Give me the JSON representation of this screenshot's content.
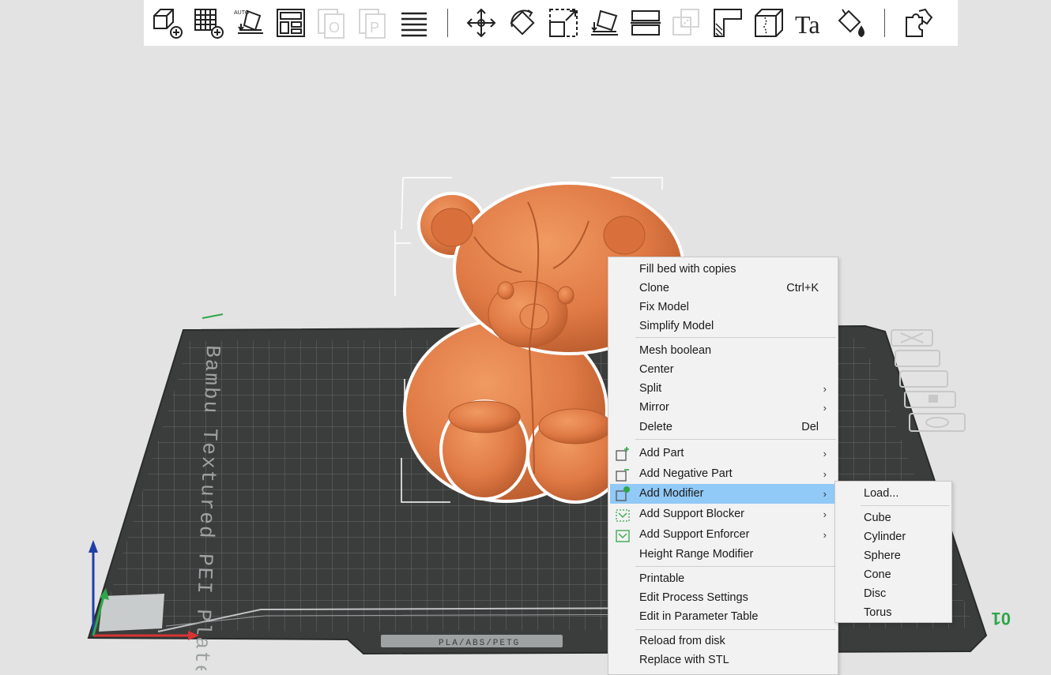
{
  "toolbar": {
    "groups": [
      [
        "add-object-icon",
        "add-plate-icon",
        "auto-orient-icon",
        "arrange-icon",
        "copy-disabled-icon",
        "paste-disabled-icon",
        "list-icon"
      ],
      [
        "move-icon",
        "rotate-icon",
        "scale-icon",
        "lay-on-face-icon",
        "cut-icon",
        "boolean-disabled-icon",
        "support-paint-icon",
        "seam-paint-icon",
        "text-icon",
        "color-paint-icon"
      ],
      [
        "assembly-icon"
      ]
    ],
    "auto_label": "AUTO",
    "text_glyph": "Ta"
  },
  "plate": {
    "name": "Bambu Textured PEI Plate",
    "material": "PLA/ABS/PETG",
    "number": "01",
    "top_color": "#3b3d3d",
    "grid_color": "#6b6d6d"
  },
  "model": {
    "name": "teddy-bear",
    "color": "#e07a45"
  },
  "context_menu": {
    "items": [
      {
        "label": "Fill bed with copies",
        "shortcut": ""
      },
      {
        "label": "Clone",
        "shortcut": "Ctrl+K"
      },
      {
        "label": "Fix Model",
        "shortcut": ""
      },
      {
        "label": "Simplify Model",
        "shortcut": ""
      },
      {
        "label": "Mesh boolean",
        "shortcut": ""
      },
      {
        "label": "Center",
        "shortcut": ""
      },
      {
        "label": "Split",
        "shortcut": ""
      },
      {
        "label": "Mirror",
        "shortcut": ""
      },
      {
        "label": "Delete",
        "shortcut": "Del"
      },
      {
        "label": "Add Part",
        "shortcut": ""
      },
      {
        "label": "Add Negative Part",
        "shortcut": ""
      },
      {
        "label": "Add Modifier",
        "shortcut": ""
      },
      {
        "label": "Add Support Blocker",
        "shortcut": ""
      },
      {
        "label": "Add Support Enforcer",
        "shortcut": ""
      },
      {
        "label": "Height Range Modifier",
        "shortcut": ""
      },
      {
        "label": "Printable",
        "shortcut": ""
      },
      {
        "label": "Edit Process Settings",
        "shortcut": ""
      },
      {
        "label": "Edit in Parameter Table",
        "shortcut": ""
      },
      {
        "label": "Reload from disk",
        "shortcut": ""
      },
      {
        "label": "Replace with STL",
        "shortcut": ""
      }
    ],
    "highlight_color": "#91c9f7"
  },
  "submenu": {
    "items": [
      "Load...",
      "Cube",
      "Cylinder",
      "Sphere",
      "Cone",
      "Disc",
      "Torus"
    ]
  }
}
